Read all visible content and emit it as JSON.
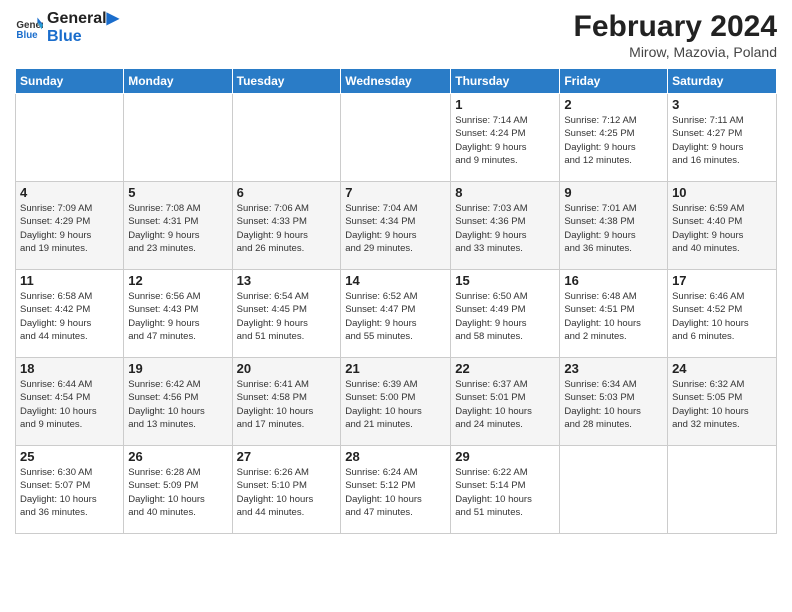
{
  "logo": {
    "line1": "General",
    "line2": "Blue"
  },
  "title": "February 2024",
  "location": "Mirow, Mazovia, Poland",
  "days_of_week": [
    "Sunday",
    "Monday",
    "Tuesday",
    "Wednesday",
    "Thursday",
    "Friday",
    "Saturday"
  ],
  "weeks": [
    [
      {
        "num": "",
        "info": ""
      },
      {
        "num": "",
        "info": ""
      },
      {
        "num": "",
        "info": ""
      },
      {
        "num": "",
        "info": ""
      },
      {
        "num": "1",
        "info": "Sunrise: 7:14 AM\nSunset: 4:24 PM\nDaylight: 9 hours\nand 9 minutes."
      },
      {
        "num": "2",
        "info": "Sunrise: 7:12 AM\nSunset: 4:25 PM\nDaylight: 9 hours\nand 12 minutes."
      },
      {
        "num": "3",
        "info": "Sunrise: 7:11 AM\nSunset: 4:27 PM\nDaylight: 9 hours\nand 16 minutes."
      }
    ],
    [
      {
        "num": "4",
        "info": "Sunrise: 7:09 AM\nSunset: 4:29 PM\nDaylight: 9 hours\nand 19 minutes."
      },
      {
        "num": "5",
        "info": "Sunrise: 7:08 AM\nSunset: 4:31 PM\nDaylight: 9 hours\nand 23 minutes."
      },
      {
        "num": "6",
        "info": "Sunrise: 7:06 AM\nSunset: 4:33 PM\nDaylight: 9 hours\nand 26 minutes."
      },
      {
        "num": "7",
        "info": "Sunrise: 7:04 AM\nSunset: 4:34 PM\nDaylight: 9 hours\nand 29 minutes."
      },
      {
        "num": "8",
        "info": "Sunrise: 7:03 AM\nSunset: 4:36 PM\nDaylight: 9 hours\nand 33 minutes."
      },
      {
        "num": "9",
        "info": "Sunrise: 7:01 AM\nSunset: 4:38 PM\nDaylight: 9 hours\nand 36 minutes."
      },
      {
        "num": "10",
        "info": "Sunrise: 6:59 AM\nSunset: 4:40 PM\nDaylight: 9 hours\nand 40 minutes."
      }
    ],
    [
      {
        "num": "11",
        "info": "Sunrise: 6:58 AM\nSunset: 4:42 PM\nDaylight: 9 hours\nand 44 minutes."
      },
      {
        "num": "12",
        "info": "Sunrise: 6:56 AM\nSunset: 4:43 PM\nDaylight: 9 hours\nand 47 minutes."
      },
      {
        "num": "13",
        "info": "Sunrise: 6:54 AM\nSunset: 4:45 PM\nDaylight: 9 hours\nand 51 minutes."
      },
      {
        "num": "14",
        "info": "Sunrise: 6:52 AM\nSunset: 4:47 PM\nDaylight: 9 hours\nand 55 minutes."
      },
      {
        "num": "15",
        "info": "Sunrise: 6:50 AM\nSunset: 4:49 PM\nDaylight: 9 hours\nand 58 minutes."
      },
      {
        "num": "16",
        "info": "Sunrise: 6:48 AM\nSunset: 4:51 PM\nDaylight: 10 hours\nand 2 minutes."
      },
      {
        "num": "17",
        "info": "Sunrise: 6:46 AM\nSunset: 4:52 PM\nDaylight: 10 hours\nand 6 minutes."
      }
    ],
    [
      {
        "num": "18",
        "info": "Sunrise: 6:44 AM\nSunset: 4:54 PM\nDaylight: 10 hours\nand 9 minutes."
      },
      {
        "num": "19",
        "info": "Sunrise: 6:42 AM\nSunset: 4:56 PM\nDaylight: 10 hours\nand 13 minutes."
      },
      {
        "num": "20",
        "info": "Sunrise: 6:41 AM\nSunset: 4:58 PM\nDaylight: 10 hours\nand 17 minutes."
      },
      {
        "num": "21",
        "info": "Sunrise: 6:39 AM\nSunset: 5:00 PM\nDaylight: 10 hours\nand 21 minutes."
      },
      {
        "num": "22",
        "info": "Sunrise: 6:37 AM\nSunset: 5:01 PM\nDaylight: 10 hours\nand 24 minutes."
      },
      {
        "num": "23",
        "info": "Sunrise: 6:34 AM\nSunset: 5:03 PM\nDaylight: 10 hours\nand 28 minutes."
      },
      {
        "num": "24",
        "info": "Sunrise: 6:32 AM\nSunset: 5:05 PM\nDaylight: 10 hours\nand 32 minutes."
      }
    ],
    [
      {
        "num": "25",
        "info": "Sunrise: 6:30 AM\nSunset: 5:07 PM\nDaylight: 10 hours\nand 36 minutes."
      },
      {
        "num": "26",
        "info": "Sunrise: 6:28 AM\nSunset: 5:09 PM\nDaylight: 10 hours\nand 40 minutes."
      },
      {
        "num": "27",
        "info": "Sunrise: 6:26 AM\nSunset: 5:10 PM\nDaylight: 10 hours\nand 44 minutes."
      },
      {
        "num": "28",
        "info": "Sunrise: 6:24 AM\nSunset: 5:12 PM\nDaylight: 10 hours\nand 47 minutes."
      },
      {
        "num": "29",
        "info": "Sunrise: 6:22 AM\nSunset: 5:14 PM\nDaylight: 10 hours\nand 51 minutes."
      },
      {
        "num": "",
        "info": ""
      },
      {
        "num": "",
        "info": ""
      }
    ]
  ]
}
